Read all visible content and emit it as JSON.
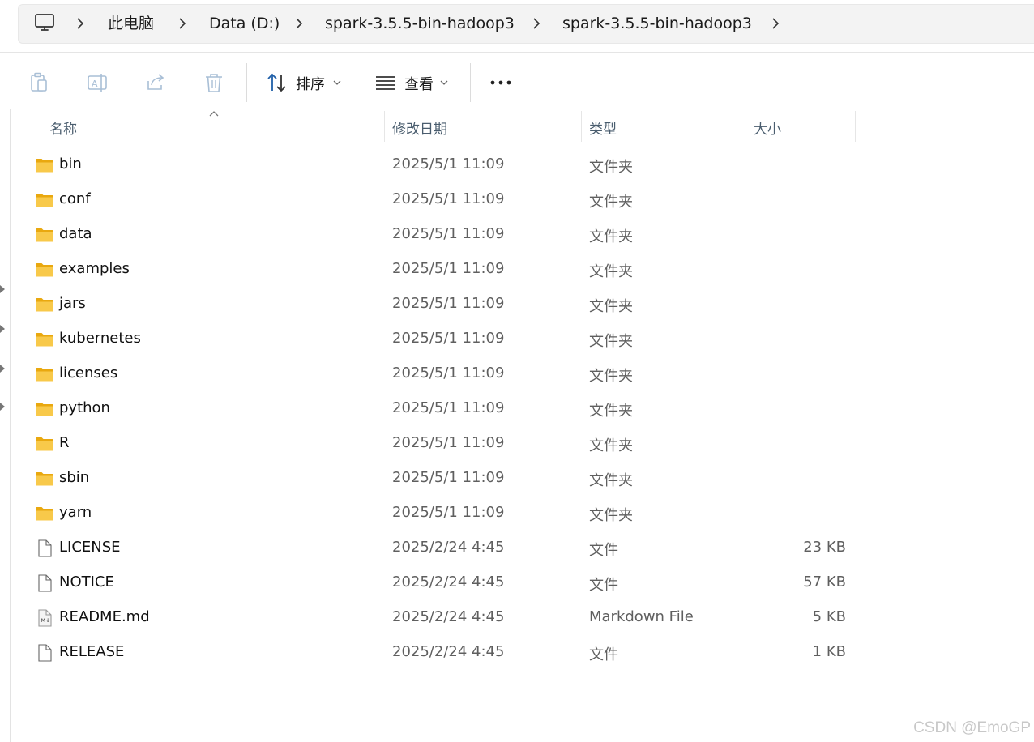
{
  "breadcrumb": {
    "items": [
      "此电脑",
      "Data (D:)",
      "spark-3.5.5-bin-hadoop3",
      "spark-3.5.5-bin-hadoop3"
    ]
  },
  "toolbar": {
    "sort_label": "排序",
    "view_label": "查看",
    "icons": [
      "clipboard-icon",
      "rename-icon",
      "share-icon",
      "delete-icon",
      "sort-icon",
      "view-icon",
      "more-icon"
    ]
  },
  "columns": {
    "name": "名称",
    "date": "修改日期",
    "type": "类型",
    "size": "大小"
  },
  "files": [
    {
      "name": "bin",
      "date": "2025/5/1 11:09",
      "type": "文件夹",
      "size": "",
      "icon": "folder-icon"
    },
    {
      "name": "conf",
      "date": "2025/5/1 11:09",
      "type": "文件夹",
      "size": "",
      "icon": "folder-icon"
    },
    {
      "name": "data",
      "date": "2025/5/1 11:09",
      "type": "文件夹",
      "size": "",
      "icon": "folder-icon"
    },
    {
      "name": "examples",
      "date": "2025/5/1 11:09",
      "type": "文件夹",
      "size": "",
      "icon": "folder-icon"
    },
    {
      "name": "jars",
      "date": "2025/5/1 11:09",
      "type": "文件夹",
      "size": "",
      "icon": "folder-icon"
    },
    {
      "name": "kubernetes",
      "date": "2025/5/1 11:09",
      "type": "文件夹",
      "size": "",
      "icon": "folder-icon"
    },
    {
      "name": "licenses",
      "date": "2025/5/1 11:09",
      "type": "文件夹",
      "size": "",
      "icon": "folder-icon"
    },
    {
      "name": "python",
      "date": "2025/5/1 11:09",
      "type": "文件夹",
      "size": "",
      "icon": "folder-icon"
    },
    {
      "name": "R",
      "date": "2025/5/1 11:09",
      "type": "文件夹",
      "size": "",
      "icon": "folder-icon"
    },
    {
      "name": "sbin",
      "date": "2025/5/1 11:09",
      "type": "文件夹",
      "size": "",
      "icon": "folder-icon"
    },
    {
      "name": "yarn",
      "date": "2025/5/1 11:09",
      "type": "文件夹",
      "size": "",
      "icon": "folder-icon"
    },
    {
      "name": "LICENSE",
      "date": "2025/2/24 4:45",
      "type": "文件",
      "size": "23 KB",
      "icon": "file-icon"
    },
    {
      "name": "NOTICE",
      "date": "2025/2/24 4:45",
      "type": "文件",
      "size": "57 KB",
      "icon": "file-icon"
    },
    {
      "name": "README.md",
      "date": "2025/2/24 4:45",
      "type": "Markdown File",
      "size": "5 KB",
      "icon": "markdown-file-icon"
    },
    {
      "name": "RELEASE",
      "date": "2025/2/24 4:45",
      "type": "文件",
      "size": "1 KB",
      "icon": "file-icon"
    }
  ],
  "watermark": "CSDN @EmoGP",
  "colors": {
    "folder": "#f8c94a",
    "folder_dark": "#e9a80f",
    "header_text": "#4a5d6e",
    "muted_text": "#5f5f5f"
  }
}
